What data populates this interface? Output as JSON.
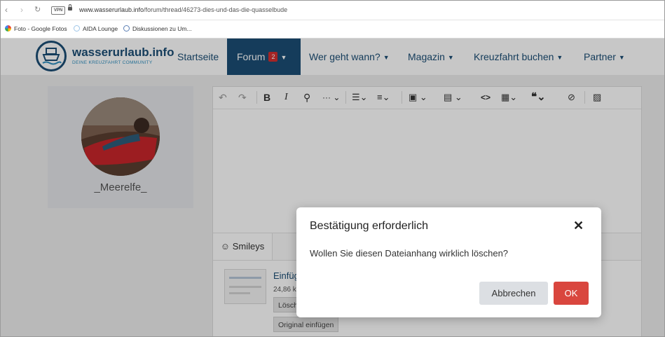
{
  "browser": {
    "url_host": "www.wasserurlaub.info",
    "url_path": "/forum/thread/46273-dies-und-das-die-quasselbude",
    "vpn_label": "VPN",
    "bookmarks": [
      {
        "label": "Foto - Google Fotos",
        "color": "#f4b400"
      },
      {
        "label": "AIDA Lounge",
        "color": "#9ec6e8"
      },
      {
        "label": "Diskussionen zu Um...",
        "color": "#5b7fb4"
      }
    ]
  },
  "site": {
    "logo_title": "wasserurlaub.info",
    "logo_subtitle": "DEINE KREUZFAHRT COMMUNITY",
    "brand_color": "#1b4e75",
    "nav": [
      {
        "label": "Startseite"
      },
      {
        "label": "Forum",
        "badge": "2",
        "active": true
      },
      {
        "label": "Wer geht wann?"
      },
      {
        "label": "Magazin"
      },
      {
        "label": "Kreuzfahrt buchen"
      },
      {
        "label": "Partner"
      }
    ]
  },
  "profile": {
    "username": "_Meerelfe_"
  },
  "editor": {
    "smileys_label": "Smileys",
    "attachment": {
      "name": "Einfüg",
      "size": "24,86 k",
      "delete_label": "Lösch",
      "insert_original_label": "Original einfügen"
    }
  },
  "dialog": {
    "title": "Bestätigung erforderlich",
    "message": "Wollen Sie diesen Dateianhang wirklich löschen?",
    "cancel_label": "Abbrechen",
    "ok_label": "OK",
    "ok_color": "#d9463e"
  }
}
